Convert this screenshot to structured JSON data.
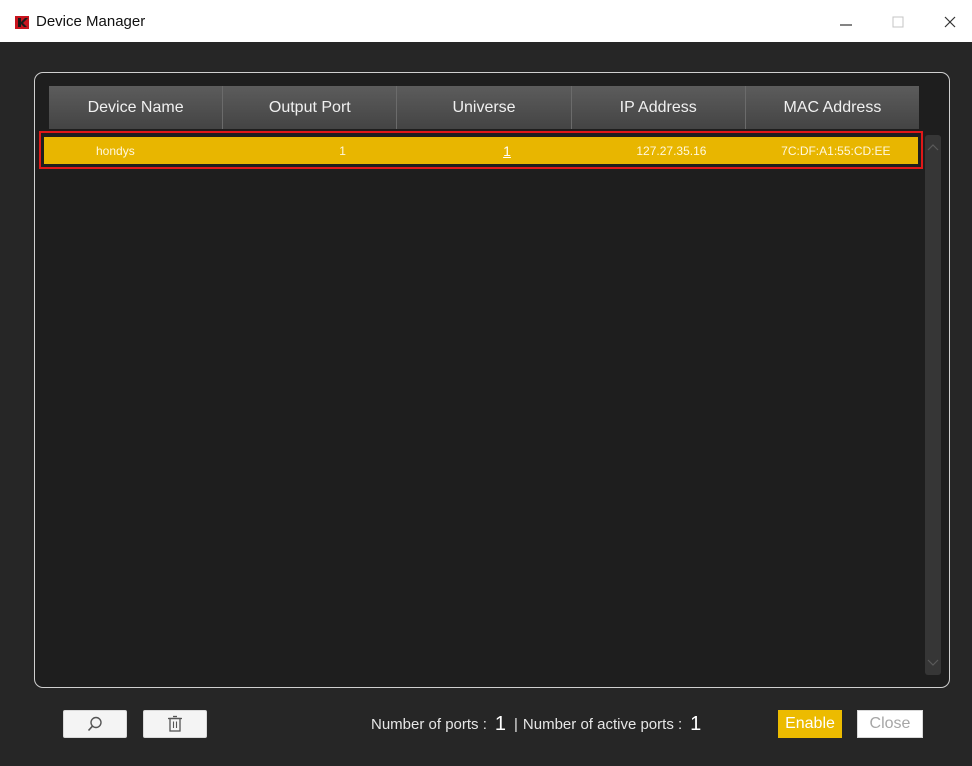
{
  "window": {
    "title": "Device Manager",
    "minimize_label": "–",
    "maximize_label": "□",
    "close_label": "×"
  },
  "table": {
    "columns": [
      "Device Name",
      "Output Port",
      "Universe",
      "IP Address",
      "MAC Address"
    ],
    "rows": [
      {
        "device_name": "hondys",
        "output_port": "1",
        "universe": "1",
        "ip_address": "127.27.35.16",
        "mac_address": "7C:DF:A1:55:CD:EE",
        "selected": true
      }
    ]
  },
  "footer": {
    "ports_label": "Number of ports :",
    "ports_value": "1",
    "separator": "|",
    "active_label": "Number of active ports :",
    "active_value": "1",
    "enable_label": "Enable",
    "close_label": "Close"
  },
  "colors": {
    "accent": "#ecbb00",
    "selection_row": "#e8b600",
    "selection_outline": "#e01818",
    "background": "#262626"
  },
  "icons": {
    "app": "app-logo-icon",
    "search": "search-icon",
    "delete": "trash-icon"
  }
}
